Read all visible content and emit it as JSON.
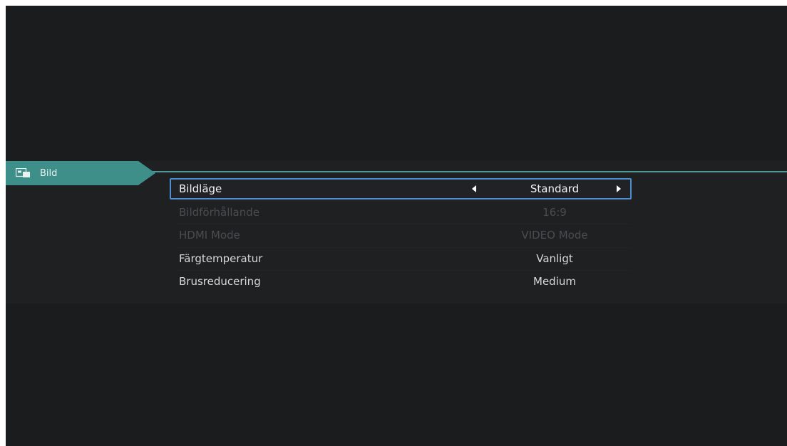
{
  "category": {
    "label": "Bild",
    "icon": "picture-settings-icon"
  },
  "menu": {
    "items": [
      {
        "label": "Bildläge",
        "value": "Standard",
        "state": "selected"
      },
      {
        "label": "Bildförhållande",
        "value": "16:9",
        "state": "disabled"
      },
      {
        "label": "HDMI Mode",
        "value": "VIDEO Mode",
        "state": "disabled"
      },
      {
        "label": "Färgtemperatur",
        "value": "Vanligt",
        "state": "normal"
      },
      {
        "label": "Brusreducering",
        "value": "Medium",
        "state": "normal"
      }
    ]
  },
  "colors": {
    "accent": "#3e8e8a",
    "focus": "#4d8fd1",
    "background": "#1b1c1e"
  }
}
